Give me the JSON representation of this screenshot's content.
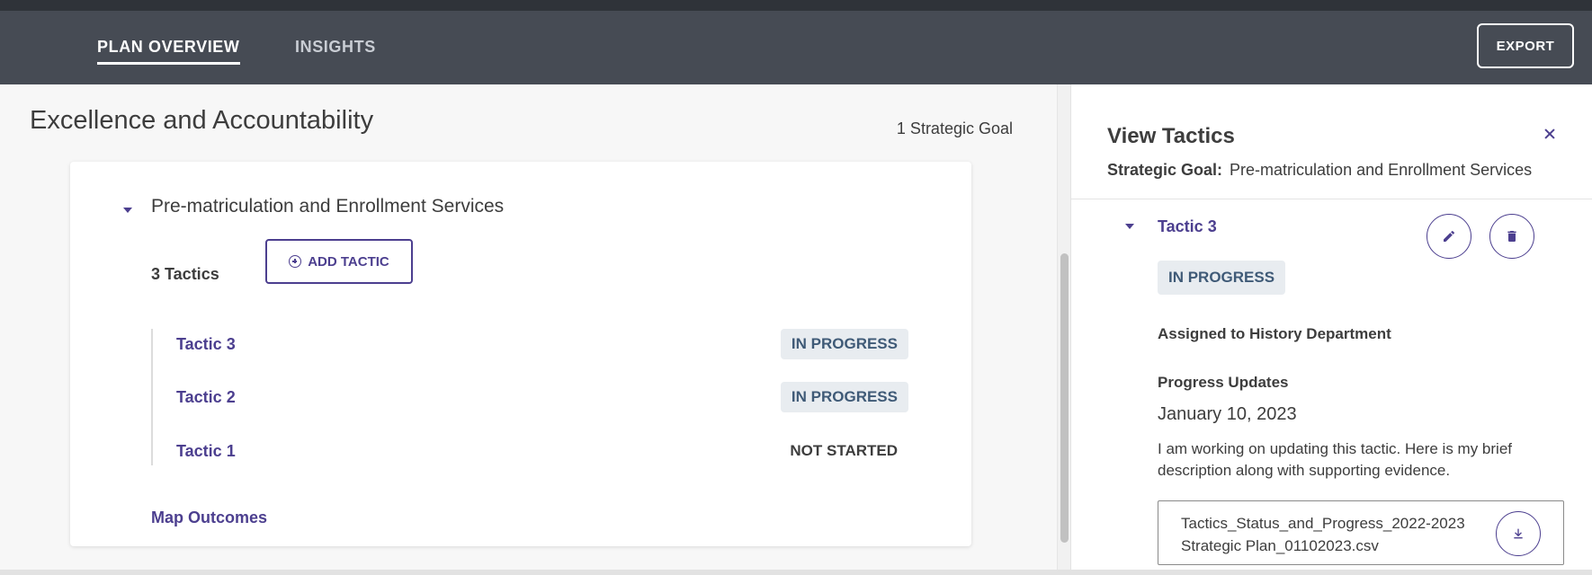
{
  "nav": {
    "tabs": [
      {
        "label": "PLAN OVERVIEW",
        "active": true
      },
      {
        "label": "INSIGHTS",
        "active": false
      }
    ],
    "export_label": "EXPORT"
  },
  "main": {
    "title": "Excellence and Accountability",
    "goal_count": "1 Strategic Goal",
    "goal": {
      "name": "Pre-matriculation and Enrollment Services",
      "tactics_count": "3 Tactics",
      "add_tactic_label": "ADD TACTIC",
      "tactics": [
        {
          "name": "Tactic 3",
          "status": "IN PROGRESS"
        },
        {
          "name": "Tactic 2",
          "status": "IN PROGRESS"
        },
        {
          "name": "Tactic 1",
          "status": "NOT STARTED"
        }
      ],
      "map_outcomes_label": "Map Outcomes"
    }
  },
  "panel": {
    "title": "View Tactics",
    "goal_label": "Strategic Goal:",
    "goal_value": "Pre-matriculation and Enrollment Services",
    "tactic": {
      "name": "Tactic 3",
      "status": "IN PROGRESS",
      "assigned": "Assigned to History Department",
      "progress_heading": "Progress Updates",
      "update_date": "January 10, 2023",
      "update_text": "I am working on updating this tactic. Here is my brief description along with supporting evidence.",
      "attachment_name": "Tactics_Status_and_Progress_2022-2023 Strategic Plan_01102023.csv"
    }
  },
  "colors": {
    "nav_bg": "#464b54",
    "accent": "#4c3f8f",
    "status_bg": "#e8ecf0",
    "status_text": "#3f5a77"
  },
  "icons": [
    "plus-circle-icon",
    "close-icon",
    "caret-down-icon",
    "pencil-icon",
    "trash-icon",
    "download-icon"
  ]
}
